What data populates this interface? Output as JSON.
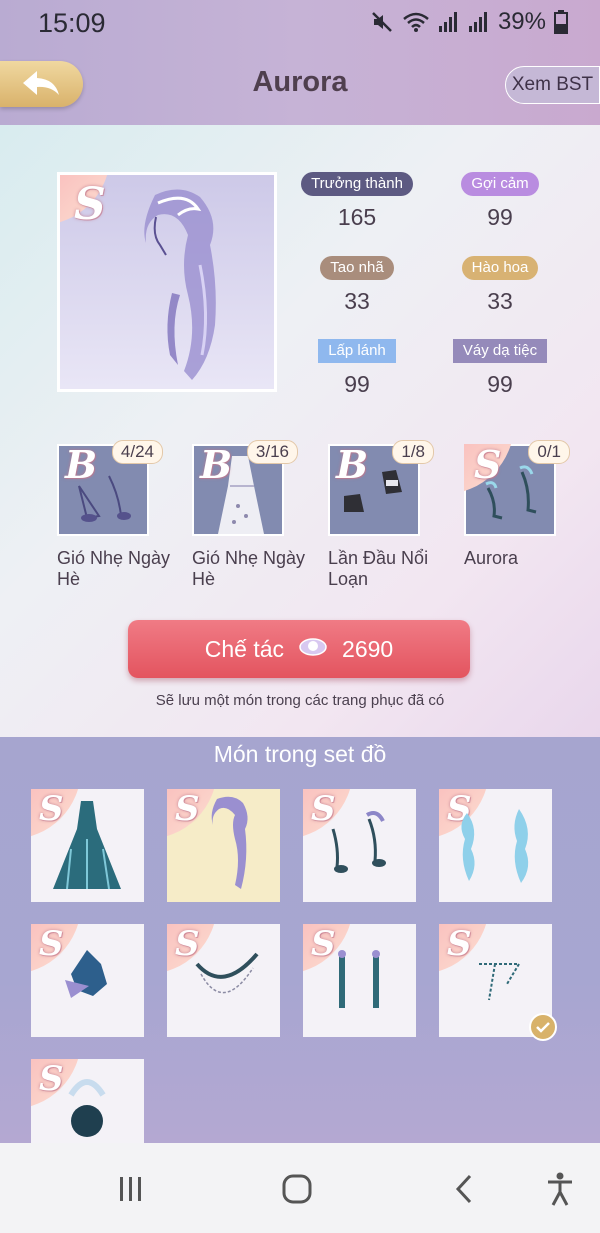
{
  "status_bar": {
    "time": "15:09",
    "battery": "39%"
  },
  "header": {
    "title": "Aurora",
    "back_label": "",
    "view_collection": "Xem BST"
  },
  "main_item": {
    "rank": "S"
  },
  "stats": [
    {
      "label": "Trưởng thành",
      "value": "165",
      "color": "#5d5a82"
    },
    {
      "label": "Gợi cảm",
      "value": "99",
      "color": "#b98ce0"
    },
    {
      "label": "Tao nhã",
      "value": "33",
      "color": "#a98d7c"
    },
    {
      "label": "Hào hoa",
      "value": "33",
      "color": "#d8b273"
    },
    {
      "label": "Lấp lánh",
      "value": "99",
      "color": "#8fb8ee"
    },
    {
      "label": "Váy dạ tiệc",
      "value": "99",
      "color": "#958aba"
    }
  ],
  "sets": [
    {
      "rank": "B",
      "count": "4/24",
      "name": "Gió Nhẹ Ngày Hè"
    },
    {
      "rank": "B",
      "count": "3/16",
      "name": "Gió Nhẹ Ngày Hè"
    },
    {
      "rank": "B",
      "count": "1/8",
      "name": "Lần Đầu Nổi Loạn"
    },
    {
      "rank": "S",
      "count": "0/1",
      "name": "Aurora"
    }
  ],
  "craft": {
    "label": "Chế tác",
    "cost": "2690",
    "note": "Sẽ lưu một món trong các trang phục đã có"
  },
  "items_section": {
    "title": "Món trong set đồ",
    "items": [
      {
        "rank": "S",
        "kind": "gown"
      },
      {
        "rank": "S",
        "kind": "hair",
        "selected": true
      },
      {
        "rank": "S",
        "kind": "shoes"
      },
      {
        "rank": "S",
        "kind": "wings"
      },
      {
        "rank": "S",
        "kind": "headdress"
      },
      {
        "rank": "S",
        "kind": "necklace"
      },
      {
        "rank": "S",
        "kind": "earrings"
      },
      {
        "rank": "S",
        "kind": "chain",
        "owned": true
      },
      {
        "rank": "S",
        "kind": "bag"
      }
    ]
  }
}
